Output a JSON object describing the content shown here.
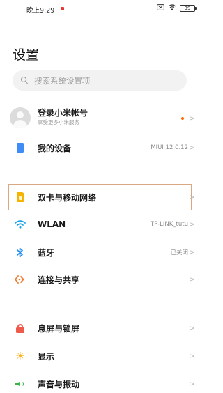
{
  "status_bar": {
    "time": "晚上9:29",
    "icons": [
      "sim-card-icon",
      "wifi-icon",
      "battery-icon"
    ],
    "battery_text": "39"
  },
  "page": {
    "title": "设置"
  },
  "search": {
    "placeholder": "搜索系统设置项"
  },
  "account": {
    "title": "登录小米帐号",
    "subtitle": "享受更多小米服务",
    "chevron": ">"
  },
  "settings": [
    {
      "id": "my-device",
      "label": "我的设备",
      "value": "MIUI 12.0.12",
      "icon": "device-icon",
      "icon_color": "#3f8cf6",
      "chevron": ">"
    },
    {
      "id": "dual-sim",
      "label": "双卡与移动网络",
      "value": "",
      "icon": "sim-card-icon",
      "icon_color": "#f4b400",
      "chevron": ">",
      "highlighted": true
    },
    {
      "id": "wlan",
      "label": "WLAN",
      "value": "TP-LINK_tutu",
      "icon": "wifi-icon",
      "icon_color": "#1aa3e8",
      "chevron": ">"
    },
    {
      "id": "bluetooth",
      "label": "蓝牙",
      "value": "已关闭",
      "icon": "bluetooth-icon",
      "icon_color": "#1f8ef1",
      "chevron": ">"
    },
    {
      "id": "connection-share",
      "label": "连接与共享",
      "value": "",
      "icon": "share-icon",
      "icon_color": "#f07a2b",
      "chevron": ">"
    },
    {
      "id": "lock-screen",
      "label": "息屏与锁屏",
      "value": "",
      "icon": "lock-icon",
      "icon_color": "#ee5a4c",
      "chevron": ">"
    },
    {
      "id": "display",
      "label": "显示",
      "value": "",
      "icon": "sun-icon",
      "icon_color": "#f9b21d",
      "chevron": ">"
    },
    {
      "id": "sound",
      "label": "声音与振动",
      "value": "",
      "icon": "speaker-icon",
      "icon_color": "#3ab54a",
      "chevron": ">"
    }
  ],
  "colors": {
    "accent_highlight_border": "#d9a882",
    "notification_dot": "#ff6a00"
  }
}
